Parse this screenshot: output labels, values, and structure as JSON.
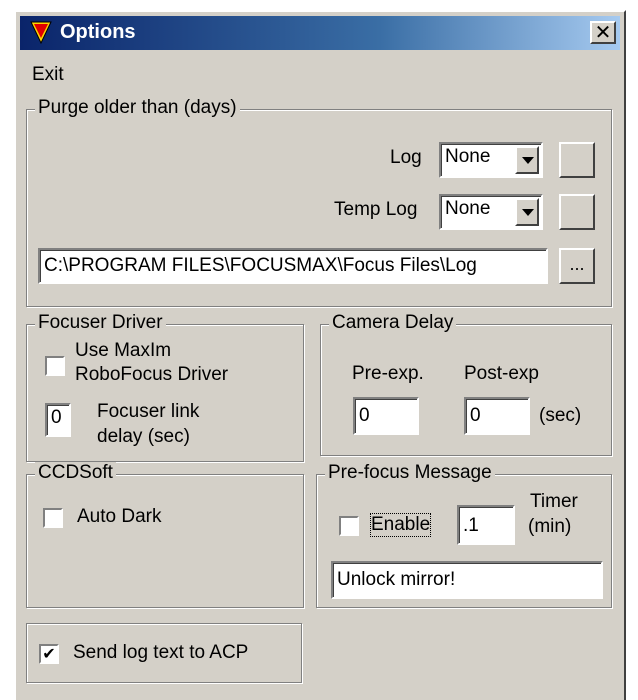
{
  "window": {
    "title": "Options",
    "close_glyph": "✕",
    "icon": "red-triangle-app-icon"
  },
  "menu": {
    "exit": "Exit"
  },
  "purge": {
    "legend": "Purge older than (days)",
    "log_label": "Log",
    "log_value": "None",
    "temp_log_label": "Temp Log",
    "temp_log_value": "None",
    "path_value": "C:\\PROGRAM FILES\\FOCUSMAX\\Focus Files\\Log",
    "browse_label": "..."
  },
  "focuser": {
    "legend": "Focuser Driver",
    "maxim_label_line1": "Use MaxIm",
    "maxim_label_line2": "RoboFocus Driver",
    "maxim_checked": false,
    "delay_value": "0",
    "delay_label_line1": "Focuser link",
    "delay_label_line2": "delay (sec)"
  },
  "camera": {
    "legend": "Camera Delay",
    "pre_label": "Pre-exp.",
    "post_label": "Post-exp",
    "pre_value": "0",
    "post_value": "0",
    "unit": "(sec)"
  },
  "ccdsoft": {
    "legend": "CCDSoft",
    "auto_dark_label": "Auto Dark",
    "auto_dark_checked": false
  },
  "prefocus": {
    "legend": "Pre-focus Message",
    "enable_label": "Enable",
    "enable_checked": false,
    "timer_value": ".1",
    "timer_label_line1": "Timer",
    "timer_label_line2": "(min)",
    "message_value": "Unlock mirror!"
  },
  "acp": {
    "label": "Send log text to ACP",
    "checked": true,
    "check_glyph": "✔"
  }
}
